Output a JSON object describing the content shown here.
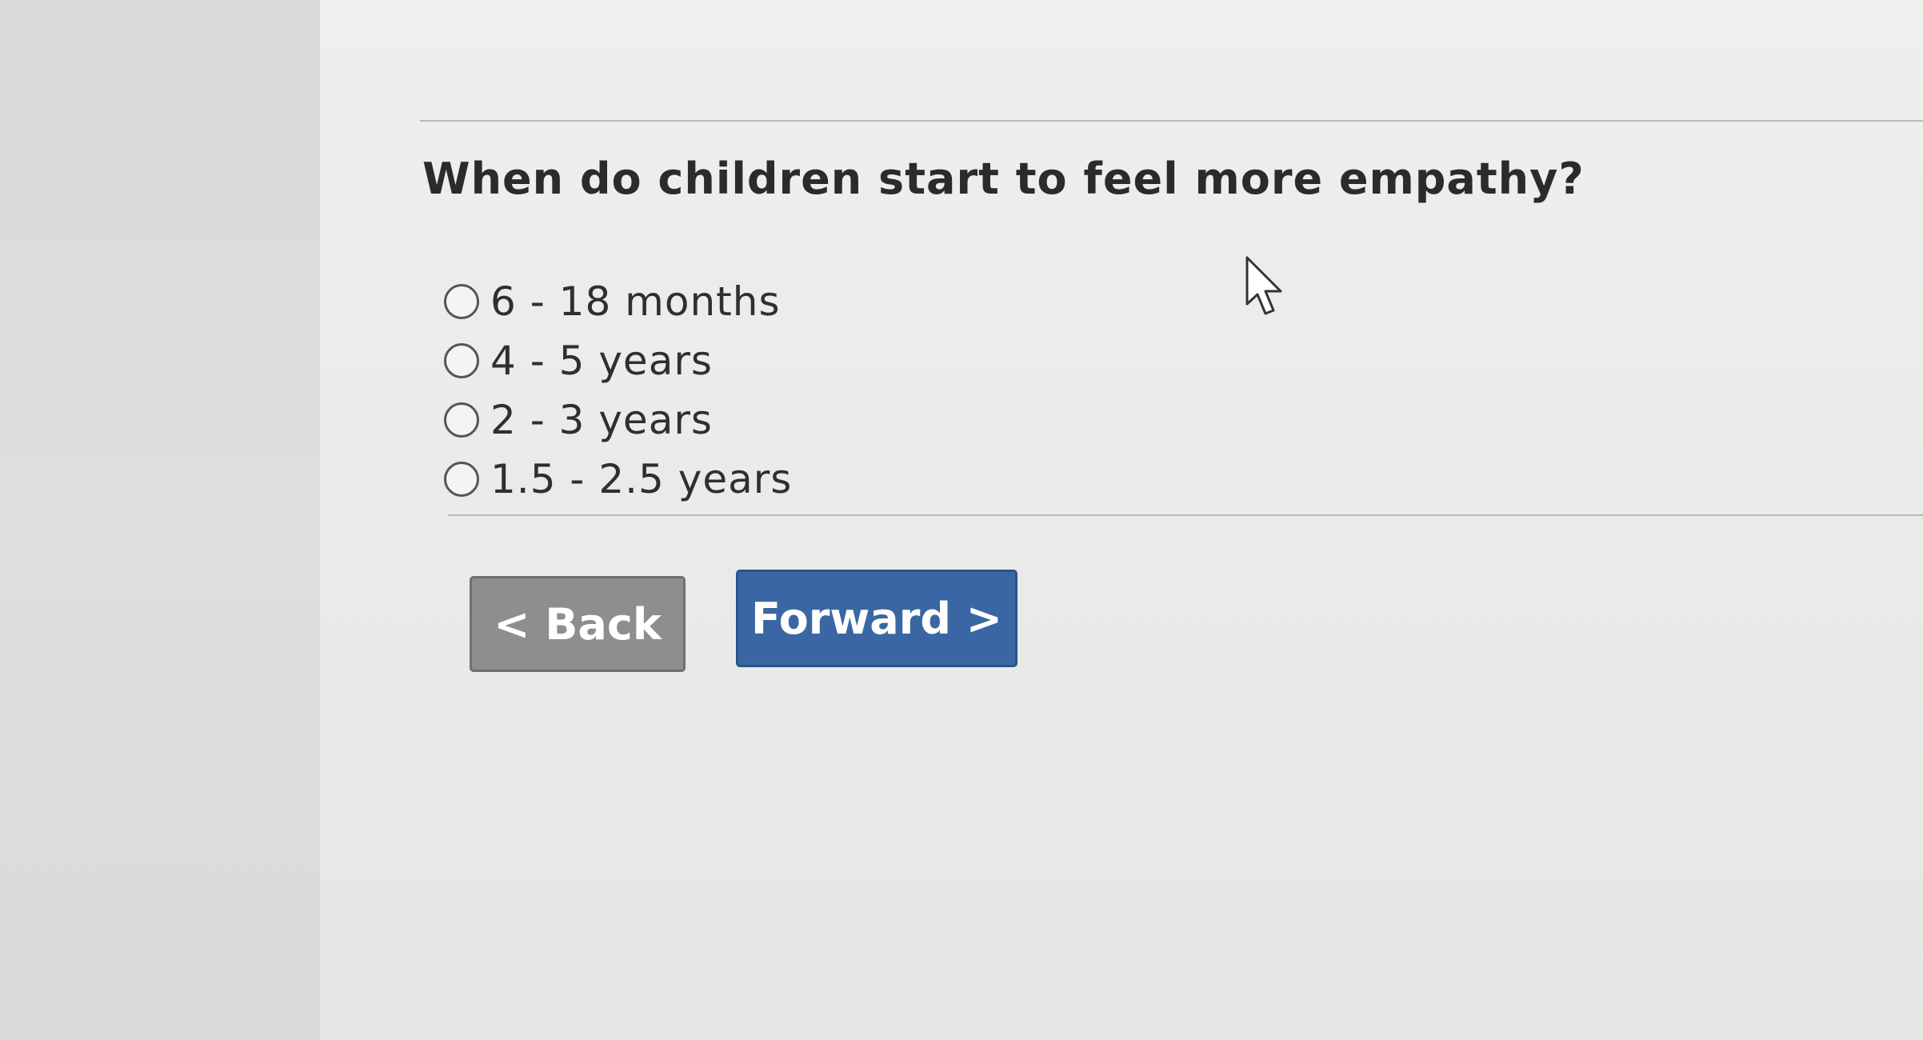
{
  "question": {
    "text": "When do children start to feel more empathy?"
  },
  "options": [
    {
      "label": "6 - 18 months",
      "selected": false
    },
    {
      "label": "4 - 5 years",
      "selected": false
    },
    {
      "label": "2 - 3 years",
      "selected": false
    },
    {
      "label": "1.5 - 2.5 years",
      "selected": false
    }
  ],
  "navigation": {
    "back_label": "< Back",
    "forward_label": "Forward >"
  },
  "colors": {
    "forward_button": "#3a67a3",
    "back_button": "#8e8e8e"
  },
  "icons": {
    "cursor": "mouse-pointer-icon"
  }
}
